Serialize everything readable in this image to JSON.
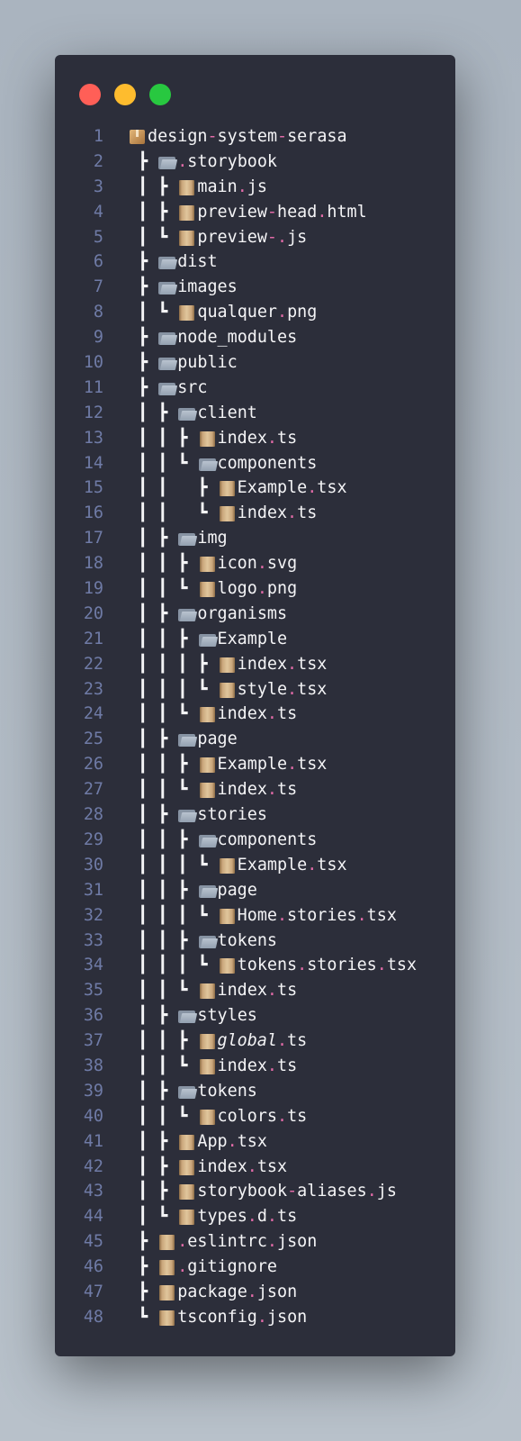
{
  "window_controls": [
    "close",
    "minimize",
    "maximize"
  ],
  "colors": {
    "background": "#2c2e3a",
    "punctuation": "#e26ba8",
    "line_number": "#6f7ba6",
    "text": "#f4f4f6"
  },
  "lines": [
    {
      "n": "1",
      "prefix": "",
      "icon": "package",
      "name": "design-system-serasa"
    },
    {
      "n": "2",
      "prefix": " ┣ ",
      "icon": "folder",
      "name": ".storybook"
    },
    {
      "n": "3",
      "prefix": " ┃ ┣ ",
      "icon": "file",
      "name": "main.js"
    },
    {
      "n": "4",
      "prefix": " ┃ ┣ ",
      "icon": "file",
      "name": "preview-head.html"
    },
    {
      "n": "5",
      "prefix": " ┃ ┗ ",
      "icon": "file",
      "name": "preview-.js"
    },
    {
      "n": "6",
      "prefix": " ┣ ",
      "icon": "folder",
      "name": "dist"
    },
    {
      "n": "7",
      "prefix": " ┣ ",
      "icon": "folder",
      "name": "images"
    },
    {
      "n": "8",
      "prefix": " ┃ ┗ ",
      "icon": "file",
      "name": "qualquer.png"
    },
    {
      "n": "9",
      "prefix": " ┣ ",
      "icon": "folder",
      "name": "node_modules"
    },
    {
      "n": "10",
      "prefix": " ┣ ",
      "icon": "folder",
      "name": "public"
    },
    {
      "n": "11",
      "prefix": " ┣ ",
      "icon": "folder",
      "name": "src"
    },
    {
      "n": "12",
      "prefix": " ┃ ┣ ",
      "icon": "folder",
      "name": "client"
    },
    {
      "n": "13",
      "prefix": " ┃ ┃ ┣ ",
      "icon": "file",
      "name": "index.ts"
    },
    {
      "n": "14",
      "prefix": " ┃ ┃ ┗ ",
      "icon": "folder",
      "name": "components"
    },
    {
      "n": "15",
      "prefix": " ┃ ┃   ┣ ",
      "icon": "file",
      "name": "Example.tsx"
    },
    {
      "n": "16",
      "prefix": " ┃ ┃   ┗ ",
      "icon": "file",
      "name": "index.ts"
    },
    {
      "n": "17",
      "prefix": " ┃ ┣ ",
      "icon": "folder",
      "name": "img"
    },
    {
      "n": "18",
      "prefix": " ┃ ┃ ┣ ",
      "icon": "file",
      "name": "icon.svg"
    },
    {
      "n": "19",
      "prefix": " ┃ ┃ ┗ ",
      "icon": "file",
      "name": "logo.png"
    },
    {
      "n": "20",
      "prefix": " ┃ ┣ ",
      "icon": "folder",
      "name": "organisms"
    },
    {
      "n": "21",
      "prefix": " ┃ ┃ ┣ ",
      "icon": "folder",
      "name": "Example"
    },
    {
      "n": "22",
      "prefix": " ┃ ┃ ┃ ┣ ",
      "icon": "file",
      "name": "index.tsx"
    },
    {
      "n": "23",
      "prefix": " ┃ ┃ ┃ ┗ ",
      "icon": "file",
      "name": "style.tsx"
    },
    {
      "n": "24",
      "prefix": " ┃ ┃ ┗ ",
      "icon": "file",
      "name": "index.ts"
    },
    {
      "n": "25",
      "prefix": " ┃ ┣ ",
      "icon": "folder",
      "name": "page"
    },
    {
      "n": "26",
      "prefix": " ┃ ┃ ┣ ",
      "icon": "file",
      "name": "Example.tsx"
    },
    {
      "n": "27",
      "prefix": " ┃ ┃ ┗ ",
      "icon": "file",
      "name": "index.ts"
    },
    {
      "n": "28",
      "prefix": " ┃ ┣ ",
      "icon": "folder",
      "name": "stories"
    },
    {
      "n": "29",
      "prefix": " ┃ ┃ ┣ ",
      "icon": "folder",
      "name": "components"
    },
    {
      "n": "30",
      "prefix": " ┃ ┃ ┃ ┗ ",
      "icon": "file",
      "name": "Example.tsx"
    },
    {
      "n": "31",
      "prefix": " ┃ ┃ ┣ ",
      "icon": "folder",
      "name": "page"
    },
    {
      "n": "32",
      "prefix": " ┃ ┃ ┃ ┗ ",
      "icon": "file",
      "name": "Home.stories.tsx"
    },
    {
      "n": "33",
      "prefix": " ┃ ┃ ┣ ",
      "icon": "folder",
      "name": "tokens"
    },
    {
      "n": "34",
      "prefix": " ┃ ┃ ┃ ┗ ",
      "icon": "file",
      "name": "tokens.stories.tsx"
    },
    {
      "n": "35",
      "prefix": " ┃ ┃ ┗ ",
      "icon": "file",
      "name": "index.ts"
    },
    {
      "n": "36",
      "prefix": " ┃ ┣ ",
      "icon": "folder",
      "name": "styles"
    },
    {
      "n": "37",
      "prefix": " ┃ ┃ ┣ ",
      "icon": "file",
      "name": "global.ts",
      "italic": "global"
    },
    {
      "n": "38",
      "prefix": " ┃ ┃ ┗ ",
      "icon": "file",
      "name": "index.ts"
    },
    {
      "n": "39",
      "prefix": " ┃ ┣ ",
      "icon": "folder",
      "name": "tokens"
    },
    {
      "n": "40",
      "prefix": " ┃ ┃ ┗ ",
      "icon": "file",
      "name": "colors.ts"
    },
    {
      "n": "41",
      "prefix": " ┃ ┣ ",
      "icon": "file",
      "name": "App.tsx"
    },
    {
      "n": "42",
      "prefix": " ┃ ┣ ",
      "icon": "file",
      "name": "index.tsx"
    },
    {
      "n": "43",
      "prefix": " ┃ ┣ ",
      "icon": "file",
      "name": "storybook-aliases.js"
    },
    {
      "n": "44",
      "prefix": " ┃ ┗ ",
      "icon": "file",
      "name": "types.d.ts"
    },
    {
      "n": "45",
      "prefix": " ┣ ",
      "icon": "file",
      "name": ".eslintrc.json"
    },
    {
      "n": "46",
      "prefix": " ┣ ",
      "icon": "file",
      "name": ".gitignore"
    },
    {
      "n": "47",
      "prefix": " ┣ ",
      "icon": "file",
      "name": "package.json"
    },
    {
      "n": "48",
      "prefix": " ┗ ",
      "icon": "file",
      "name": "tsconfig.json"
    }
  ]
}
